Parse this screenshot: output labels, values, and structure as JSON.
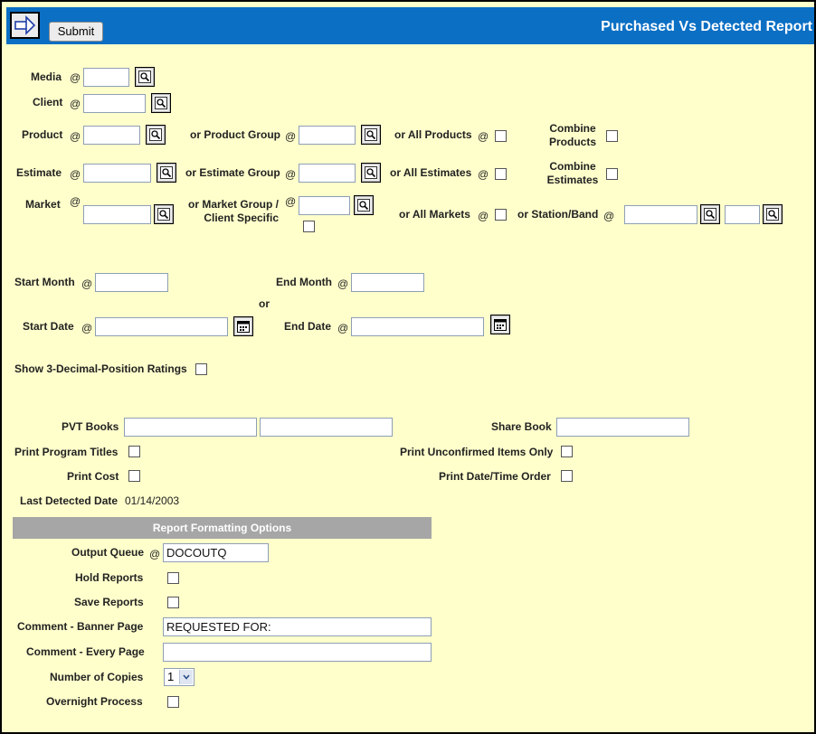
{
  "header": {
    "title": "Purchased Vs Detected Report",
    "submit_label": "Submit",
    "bg_color": "#0b6fc4"
  },
  "selection": {
    "media": "Media",
    "client": "Client",
    "product": "Product",
    "product_group": "or Product Group",
    "all_products": "or All Products",
    "combine_products": "Combine Products",
    "estimate": "Estimate",
    "estimate_group": "or Estimate Group",
    "all_estimates": "or All Estimates",
    "combine_estimates": "Combine Estimates",
    "market": "Market",
    "market_group": "or Market Group / Client Specific",
    "all_markets": "or All Markets",
    "station_band": "or Station/Band",
    "at_symbol": "@"
  },
  "dates": {
    "start_month": "Start Month",
    "end_month": "End Month",
    "or_text": "or",
    "start_date": "Start Date",
    "end_date": "End Date",
    "show_3_decimal": "Show 3-Decimal-Position Ratings"
  },
  "options": {
    "pvt_books": "PVT Books",
    "share_book": "Share Book",
    "print_program_titles": "Print Program Titles",
    "print_unconfirmed": "Print Unconfirmed Items Only",
    "print_cost": "Print Cost",
    "print_date_time_order": "Print Date/Time Order",
    "last_detected_label": "Last Detected Date",
    "last_detected_value": "01/14/2003"
  },
  "formatting": {
    "section_title": "Report Formatting Options",
    "output_queue_label": "Output Queue",
    "output_queue_value": "DOCOUTQ",
    "hold_reports": "Hold Reports",
    "save_reports": "Save Reports",
    "comment_banner_label": "Comment - Banner Page",
    "comment_banner_value": "REQUESTED FOR:",
    "comment_every_label": "Comment - Every Page",
    "comment_every_value": "",
    "copies_label": "Number of Copies",
    "copies_value": "1",
    "overnight_label": "Overnight Process"
  },
  "colors": {
    "panel_bg": "#ffffcc",
    "section_bar": "#a6a6a6"
  },
  "icons": {
    "nav": "arrow-right-icon",
    "lookup": "magnifier-icon",
    "calendar": "calendar-icon"
  }
}
